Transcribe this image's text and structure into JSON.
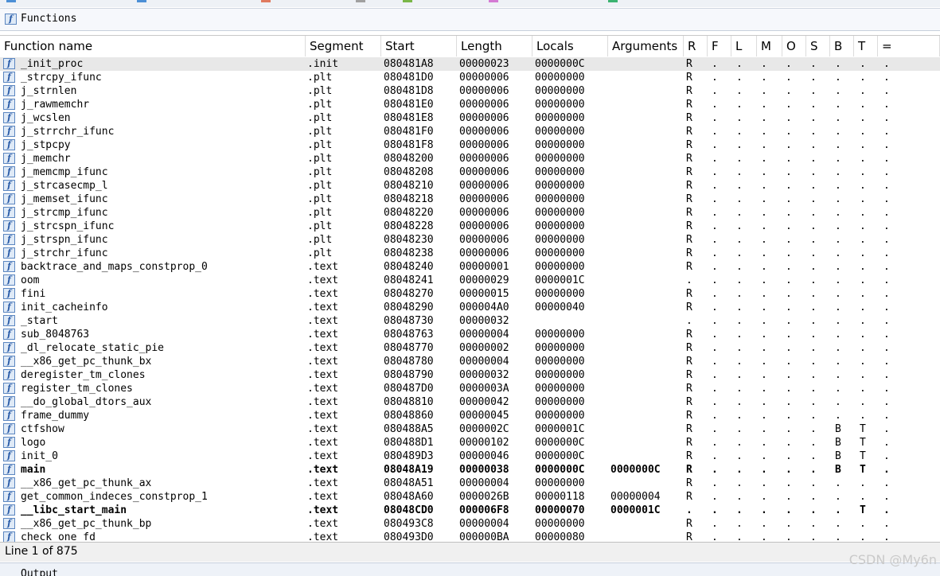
{
  "window": {
    "panel_title": "Functions",
    "status_text": "Line 1 of 875",
    "output_title": "Output",
    "watermark": "CSDN @My6n"
  },
  "accent_colors": {
    "top_marks": [
      "#4c8fd6",
      "#4c8fd6",
      "#e07a5f",
      "#a0a0a0",
      "#7ab648",
      "#d47ad4",
      "#3cb371"
    ],
    "icon_border": "#5b86c0",
    "selected_row": "#e8e8e8"
  },
  "icons": {
    "function": "function-icon"
  },
  "table": {
    "columns": [
      "Function name",
      "Segment",
      "Start",
      "Length",
      "Locals",
      "Arguments",
      "R",
      "F",
      "L",
      "M",
      "O",
      "S",
      "B",
      "T",
      "="
    ],
    "rows": [
      {
        "name": "_init_proc",
        "segment": ".init",
        "start": "080481A8",
        "length": "00000023",
        "locals": "0000000C",
        "args": "",
        "r": "R",
        "f": ".",
        "l": ".",
        "m": ".",
        "o": ".",
        "s": ".",
        "b": ".",
        "t": ".",
        "eq": ".",
        "selected": true,
        "bold": false
      },
      {
        "name": "_strcpy_ifunc",
        "segment": ".plt",
        "start": "080481D0",
        "length": "00000006",
        "locals": "00000000",
        "args": "",
        "r": "R",
        "f": ".",
        "l": ".",
        "m": ".",
        "o": ".",
        "s": ".",
        "b": ".",
        "t": ".",
        "eq": ".",
        "selected": false,
        "bold": false
      },
      {
        "name": "j_strnlen",
        "segment": ".plt",
        "start": "080481D8",
        "length": "00000006",
        "locals": "00000000",
        "args": "",
        "r": "R",
        "f": ".",
        "l": ".",
        "m": ".",
        "o": ".",
        "s": ".",
        "b": ".",
        "t": ".",
        "eq": ".",
        "selected": false,
        "bold": false
      },
      {
        "name": "j_rawmemchr",
        "segment": ".plt",
        "start": "080481E0",
        "length": "00000006",
        "locals": "00000000",
        "args": "",
        "r": "R",
        "f": ".",
        "l": ".",
        "m": ".",
        "o": ".",
        "s": ".",
        "b": ".",
        "t": ".",
        "eq": ".",
        "selected": false,
        "bold": false
      },
      {
        "name": "j_wcslen",
        "segment": ".plt",
        "start": "080481E8",
        "length": "00000006",
        "locals": "00000000",
        "args": "",
        "r": "R",
        "f": ".",
        "l": ".",
        "m": ".",
        "o": ".",
        "s": ".",
        "b": ".",
        "t": ".",
        "eq": ".",
        "selected": false,
        "bold": false
      },
      {
        "name": "j_strrchr_ifunc",
        "segment": ".plt",
        "start": "080481F0",
        "length": "00000006",
        "locals": "00000000",
        "args": "",
        "r": "R",
        "f": ".",
        "l": ".",
        "m": ".",
        "o": ".",
        "s": ".",
        "b": ".",
        "t": ".",
        "eq": ".",
        "selected": false,
        "bold": false
      },
      {
        "name": "j_stpcpy",
        "segment": ".plt",
        "start": "080481F8",
        "length": "00000006",
        "locals": "00000000",
        "args": "",
        "r": "R",
        "f": ".",
        "l": ".",
        "m": ".",
        "o": ".",
        "s": ".",
        "b": ".",
        "t": ".",
        "eq": ".",
        "selected": false,
        "bold": false
      },
      {
        "name": "j_memchr",
        "segment": ".plt",
        "start": "08048200",
        "length": "00000006",
        "locals": "00000000",
        "args": "",
        "r": "R",
        "f": ".",
        "l": ".",
        "m": ".",
        "o": ".",
        "s": ".",
        "b": ".",
        "t": ".",
        "eq": ".",
        "selected": false,
        "bold": false
      },
      {
        "name": "j_memcmp_ifunc",
        "segment": ".plt",
        "start": "08048208",
        "length": "00000006",
        "locals": "00000000",
        "args": "",
        "r": "R",
        "f": ".",
        "l": ".",
        "m": ".",
        "o": ".",
        "s": ".",
        "b": ".",
        "t": ".",
        "eq": ".",
        "selected": false,
        "bold": false
      },
      {
        "name": "j_strcasecmp_l",
        "segment": ".plt",
        "start": "08048210",
        "length": "00000006",
        "locals": "00000000",
        "args": "",
        "r": "R",
        "f": ".",
        "l": ".",
        "m": ".",
        "o": ".",
        "s": ".",
        "b": ".",
        "t": ".",
        "eq": ".",
        "selected": false,
        "bold": false
      },
      {
        "name": "j_memset_ifunc",
        "segment": ".plt",
        "start": "08048218",
        "length": "00000006",
        "locals": "00000000",
        "args": "",
        "r": "R",
        "f": ".",
        "l": ".",
        "m": ".",
        "o": ".",
        "s": ".",
        "b": ".",
        "t": ".",
        "eq": ".",
        "selected": false,
        "bold": false
      },
      {
        "name": "j_strcmp_ifunc",
        "segment": ".plt",
        "start": "08048220",
        "length": "00000006",
        "locals": "00000000",
        "args": "",
        "r": "R",
        "f": ".",
        "l": ".",
        "m": ".",
        "o": ".",
        "s": ".",
        "b": ".",
        "t": ".",
        "eq": ".",
        "selected": false,
        "bold": false
      },
      {
        "name": "j_strcspn_ifunc",
        "segment": ".plt",
        "start": "08048228",
        "length": "00000006",
        "locals": "00000000",
        "args": "",
        "r": "R",
        "f": ".",
        "l": ".",
        "m": ".",
        "o": ".",
        "s": ".",
        "b": ".",
        "t": ".",
        "eq": ".",
        "selected": false,
        "bold": false
      },
      {
        "name": "j_strspn_ifunc",
        "segment": ".plt",
        "start": "08048230",
        "length": "00000006",
        "locals": "00000000",
        "args": "",
        "r": "R",
        "f": ".",
        "l": ".",
        "m": ".",
        "o": ".",
        "s": ".",
        "b": ".",
        "t": ".",
        "eq": ".",
        "selected": false,
        "bold": false
      },
      {
        "name": "j_strchr_ifunc",
        "segment": ".plt",
        "start": "08048238",
        "length": "00000006",
        "locals": "00000000",
        "args": "",
        "r": "R",
        "f": ".",
        "l": ".",
        "m": ".",
        "o": ".",
        "s": ".",
        "b": ".",
        "t": ".",
        "eq": ".",
        "selected": false,
        "bold": false
      },
      {
        "name": "backtrace_and_maps_constprop_0",
        "segment": ".text",
        "start": "08048240",
        "length": "00000001",
        "locals": "00000000",
        "args": "",
        "r": "R",
        "f": ".",
        "l": ".",
        "m": ".",
        "o": ".",
        "s": ".",
        "b": ".",
        "t": ".",
        "eq": ".",
        "selected": false,
        "bold": false
      },
      {
        "name": "oom",
        "segment": ".text",
        "start": "08048241",
        "length": "00000029",
        "locals": "0000001C",
        "args": "",
        "r": ".",
        "f": ".",
        "l": ".",
        "m": ".",
        "o": ".",
        "s": ".",
        "b": ".",
        "t": ".",
        "eq": ".",
        "selected": false,
        "bold": false
      },
      {
        "name": "fini",
        "segment": ".text",
        "start": "08048270",
        "length": "00000015",
        "locals": "00000000",
        "args": "",
        "r": "R",
        "f": ".",
        "l": ".",
        "m": ".",
        "o": ".",
        "s": ".",
        "b": ".",
        "t": ".",
        "eq": ".",
        "selected": false,
        "bold": false
      },
      {
        "name": "init_cacheinfo",
        "segment": ".text",
        "start": "08048290",
        "length": "000004A0",
        "locals": "00000040",
        "args": "",
        "r": "R",
        "f": ".",
        "l": ".",
        "m": ".",
        "o": ".",
        "s": ".",
        "b": ".",
        "t": ".",
        "eq": ".",
        "selected": false,
        "bold": false
      },
      {
        "name": "_start",
        "segment": ".text",
        "start": "08048730",
        "length": "00000032",
        "locals": "",
        "args": "",
        "r": ".",
        "f": ".",
        "l": ".",
        "m": ".",
        "o": ".",
        "s": ".",
        "b": ".",
        "t": ".",
        "eq": ".",
        "selected": false,
        "bold": false
      },
      {
        "name": "sub_8048763",
        "segment": ".text",
        "start": "08048763",
        "length": "00000004",
        "locals": "00000000",
        "args": "",
        "r": "R",
        "f": ".",
        "l": ".",
        "m": ".",
        "o": ".",
        "s": ".",
        "b": ".",
        "t": ".",
        "eq": ".",
        "selected": false,
        "bold": false
      },
      {
        "name": "_dl_relocate_static_pie",
        "segment": ".text",
        "start": "08048770",
        "length": "00000002",
        "locals": "00000000",
        "args": "",
        "r": "R",
        "f": ".",
        "l": ".",
        "m": ".",
        "o": ".",
        "s": ".",
        "b": ".",
        "t": ".",
        "eq": ".",
        "selected": false,
        "bold": false
      },
      {
        "name": "__x86_get_pc_thunk_bx",
        "segment": ".text",
        "start": "08048780",
        "length": "00000004",
        "locals": "00000000",
        "args": "",
        "r": "R",
        "f": ".",
        "l": ".",
        "m": ".",
        "o": ".",
        "s": ".",
        "b": ".",
        "t": ".",
        "eq": ".",
        "selected": false,
        "bold": false
      },
      {
        "name": "deregister_tm_clones",
        "segment": ".text",
        "start": "08048790",
        "length": "00000032",
        "locals": "00000000",
        "args": "",
        "r": "R",
        "f": ".",
        "l": ".",
        "m": ".",
        "o": ".",
        "s": ".",
        "b": ".",
        "t": ".",
        "eq": ".",
        "selected": false,
        "bold": false
      },
      {
        "name": "register_tm_clones",
        "segment": ".text",
        "start": "080487D0",
        "length": "0000003A",
        "locals": "00000000",
        "args": "",
        "r": "R",
        "f": ".",
        "l": ".",
        "m": ".",
        "o": ".",
        "s": ".",
        "b": ".",
        "t": ".",
        "eq": ".",
        "selected": false,
        "bold": false
      },
      {
        "name": "__do_global_dtors_aux",
        "segment": ".text",
        "start": "08048810",
        "length": "00000042",
        "locals": "00000000",
        "args": "",
        "r": "R",
        "f": ".",
        "l": ".",
        "m": ".",
        "o": ".",
        "s": ".",
        "b": ".",
        "t": ".",
        "eq": ".",
        "selected": false,
        "bold": false
      },
      {
        "name": "frame_dummy",
        "segment": ".text",
        "start": "08048860",
        "length": "00000045",
        "locals": "00000000",
        "args": "",
        "r": "R",
        "f": ".",
        "l": ".",
        "m": ".",
        "o": ".",
        "s": ".",
        "b": ".",
        "t": ".",
        "eq": ".",
        "selected": false,
        "bold": false
      },
      {
        "name": "ctfshow",
        "segment": ".text",
        "start": "080488A5",
        "length": "0000002C",
        "locals": "0000001C",
        "args": "",
        "r": "R",
        "f": ".",
        "l": ".",
        "m": ".",
        "o": ".",
        "s": ".",
        "b": "B",
        "t": "T",
        "eq": ".",
        "selected": false,
        "bold": false
      },
      {
        "name": "logo",
        "segment": ".text",
        "start": "080488D1",
        "length": "00000102",
        "locals": "0000000C",
        "args": "",
        "r": "R",
        "f": ".",
        "l": ".",
        "m": ".",
        "o": ".",
        "s": ".",
        "b": "B",
        "t": "T",
        "eq": ".",
        "selected": false,
        "bold": false
      },
      {
        "name": "init_0",
        "segment": ".text",
        "start": "080489D3",
        "length": "00000046",
        "locals": "0000000C",
        "args": "",
        "r": "R",
        "f": ".",
        "l": ".",
        "m": ".",
        "o": ".",
        "s": ".",
        "b": "B",
        "t": "T",
        "eq": ".",
        "selected": false,
        "bold": false
      },
      {
        "name": "main",
        "segment": ".text",
        "start": "08048A19",
        "length": "00000038",
        "locals": "0000000C",
        "args": "0000000C",
        "r": "R",
        "f": ".",
        "l": ".",
        "m": ".",
        "o": ".",
        "s": ".",
        "b": "B",
        "t": "T",
        "eq": ".",
        "selected": false,
        "bold": true
      },
      {
        "name": "__x86_get_pc_thunk_ax",
        "segment": ".text",
        "start": "08048A51",
        "length": "00000004",
        "locals": "00000000",
        "args": "",
        "r": "R",
        "f": ".",
        "l": ".",
        "m": ".",
        "o": ".",
        "s": ".",
        "b": ".",
        "t": ".",
        "eq": ".",
        "selected": false,
        "bold": false
      },
      {
        "name": "get_common_indeces_constprop_1",
        "segment": ".text",
        "start": "08048A60",
        "length": "0000026B",
        "locals": "00000118",
        "args": "00000004",
        "r": "R",
        "f": ".",
        "l": ".",
        "m": ".",
        "o": ".",
        "s": ".",
        "b": ".",
        "t": ".",
        "eq": ".",
        "selected": false,
        "bold": false
      },
      {
        "name": "__libc_start_main",
        "segment": ".text",
        "start": "08048CD0",
        "length": "000006F8",
        "locals": "00000070",
        "args": "0000001C",
        "r": ".",
        "f": ".",
        "l": ".",
        "m": ".",
        "o": ".",
        "s": ".",
        "b": ".",
        "t": "T",
        "eq": ".",
        "selected": false,
        "bold": true
      },
      {
        "name": "__x86_get_pc_thunk_bp",
        "segment": ".text",
        "start": "080493C8",
        "length": "00000004",
        "locals": "00000000",
        "args": "",
        "r": "R",
        "f": ".",
        "l": ".",
        "m": ".",
        "o": ".",
        "s": ".",
        "b": ".",
        "t": ".",
        "eq": ".",
        "selected": false,
        "bold": false
      },
      {
        "name": "check_one_fd",
        "segment": ".text",
        "start": "080493D0",
        "length": "000000BA",
        "locals": "00000080",
        "args": "",
        "r": "R",
        "f": ".",
        "l": ".",
        "m": ".",
        "o": ".",
        "s": ".",
        "b": ".",
        "t": ".",
        "eq": ".",
        "selected": false,
        "bold": false
      }
    ]
  }
}
